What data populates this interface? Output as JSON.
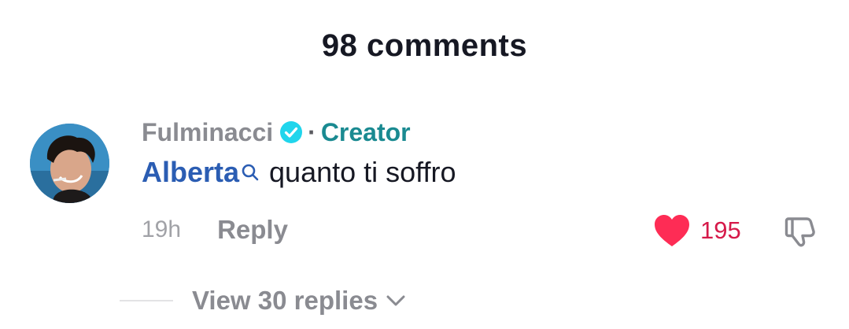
{
  "header": {
    "title": "98 comments"
  },
  "comment": {
    "author": "Fulminacci",
    "separator": "·",
    "author_badge": "Creator",
    "mention": "Alberta",
    "text": "quanto ti soffro",
    "time": "19h",
    "reply_label": "Reply",
    "like_count": "195",
    "view_replies_label": "View 30 replies"
  },
  "colors": {
    "heart": "#fe2c55",
    "verified": "#20d5ec",
    "creator": "#1a8a91",
    "mention": "#2b5db3"
  },
  "icons": [
    "verified-icon",
    "search-icon",
    "heart-icon",
    "thumbs-down-icon",
    "chevron-down-icon"
  ]
}
